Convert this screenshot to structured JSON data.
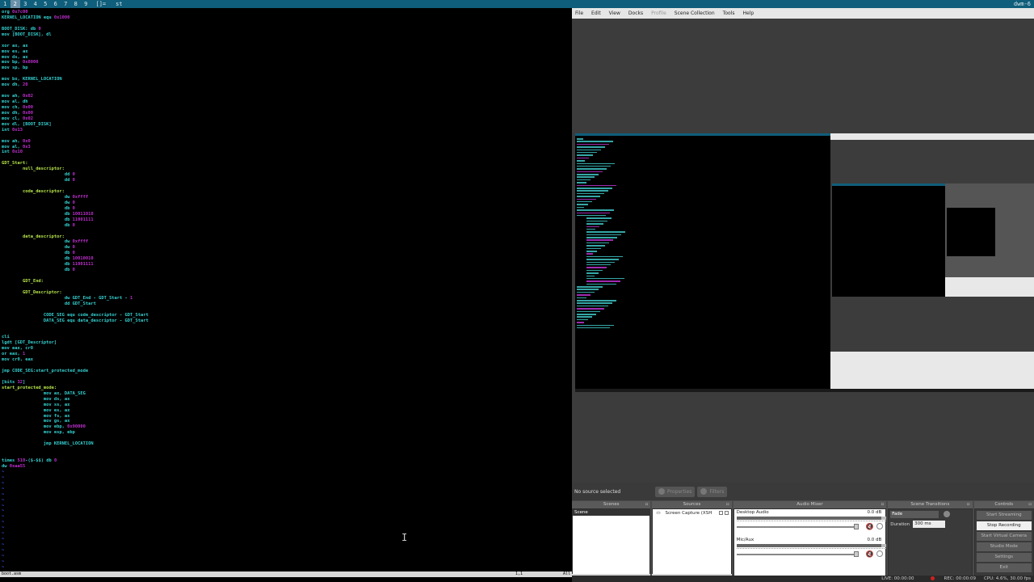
{
  "dwm": {
    "tags": [
      "1",
      "2",
      "3",
      "4",
      "5",
      "6",
      "7",
      "8",
      "9"
    ],
    "selected_tag": 1,
    "layout": "[]=",
    "window_title": "st",
    "status": "dwm-6"
  },
  "vim": {
    "lines": [
      [
        [
          "org ",
          "kw"
        ],
        [
          "0x7c00",
          "num"
        ]
      ],
      [
        [
          "KERNEL_LOCATION equ ",
          "kw"
        ],
        [
          "0x1000",
          "num"
        ]
      ],
      [],
      [
        [
          "BOOT_DISK: db ",
          "kw"
        ],
        [
          "0",
          "num"
        ]
      ],
      [
        [
          "mov [BOOT_DISK], dl",
          "kw"
        ]
      ],
      [],
      [
        [
          "xor ax, ax",
          "kw"
        ]
      ],
      [
        [
          "mov es, ax",
          "kw"
        ]
      ],
      [
        [
          "mov ds, ax",
          "kw"
        ]
      ],
      [
        [
          "mov bp, ",
          "kw"
        ],
        [
          "0x8000",
          "num"
        ]
      ],
      [
        [
          "mov sp, bp",
          "kw"
        ]
      ],
      [],
      [
        [
          "mov bx, KERNEL_LOCATION",
          "kw"
        ]
      ],
      [
        [
          "mov dh, ",
          "kw"
        ],
        [
          "20",
          "num"
        ]
      ],
      [],
      [
        [
          "mov ah, ",
          "kw"
        ],
        [
          "0x02",
          "num"
        ]
      ],
      [
        [
          "mov al, dh",
          "kw"
        ]
      ],
      [
        [
          "mov ch, ",
          "kw"
        ],
        [
          "0x00",
          "num"
        ]
      ],
      [
        [
          "mov dh, ",
          "kw"
        ],
        [
          "0x00",
          "num"
        ]
      ],
      [
        [
          "mov cl, ",
          "kw"
        ],
        [
          "0x02",
          "num"
        ]
      ],
      [
        [
          "mov dl, [BOOT_DISK]",
          "kw"
        ]
      ],
      [
        [
          "int ",
          "kw"
        ],
        [
          "0x13",
          "num"
        ]
      ],
      [],
      [
        [
          "mov ah, ",
          "kw"
        ],
        [
          "0x0",
          "num"
        ]
      ],
      [
        [
          "mov al, ",
          "kw"
        ],
        [
          "0x3",
          "num"
        ]
      ],
      [
        [
          "int ",
          "kw"
        ],
        [
          "0x10",
          "num"
        ]
      ],
      [],
      [
        [
          "GDT_Start:",
          "lb"
        ]
      ],
      [
        [
          "        null_descriptor:",
          "lb"
        ]
      ],
      [
        [
          "                        dd ",
          "kw"
        ],
        [
          "0",
          "num"
        ]
      ],
      [
        [
          "                        dd ",
          "kw"
        ],
        [
          "0",
          "num"
        ]
      ],
      [],
      [
        [
          "        code_descriptor:",
          "lb"
        ]
      ],
      [
        [
          "                        dw ",
          "kw"
        ],
        [
          "0xffff",
          "num"
        ]
      ],
      [
        [
          "                        dw ",
          "kw"
        ],
        [
          "0",
          "num"
        ]
      ],
      [
        [
          "                        db ",
          "kw"
        ],
        [
          "0",
          "num"
        ]
      ],
      [
        [
          "                        db ",
          "kw"
        ],
        [
          "10011010",
          "num"
        ]
      ],
      [
        [
          "                        db ",
          "kw"
        ],
        [
          "11001111",
          "num"
        ]
      ],
      [
        [
          "                        db ",
          "kw"
        ],
        [
          "0",
          "num"
        ]
      ],
      [],
      [
        [
          "        data_descriptor:",
          "lb"
        ]
      ],
      [
        [
          "                        dw ",
          "kw"
        ],
        [
          "0xffff",
          "num"
        ]
      ],
      [
        [
          "                        dw ",
          "kw"
        ],
        [
          "0",
          "num"
        ]
      ],
      [
        [
          "                        db ",
          "kw"
        ],
        [
          "0",
          "num"
        ]
      ],
      [
        [
          "                        db ",
          "kw"
        ],
        [
          "10010010",
          "num"
        ]
      ],
      [
        [
          "                        db ",
          "kw"
        ],
        [
          "11001111",
          "num"
        ]
      ],
      [
        [
          "                        db ",
          "kw"
        ],
        [
          "0",
          "num"
        ]
      ],
      [],
      [
        [
          "        GDT_End:",
          "lb"
        ]
      ],
      [],
      [
        [
          "        GDT_Descriptor:",
          "lb"
        ]
      ],
      [
        [
          "                        dw GDT_End - GDT_Start - ",
          "kw"
        ],
        [
          "1",
          "num"
        ]
      ],
      [
        [
          "                        dd GDT_Start",
          "kw"
        ]
      ],
      [],
      [
        [
          "                CODE_SEG equ code_descriptor - GDT_Start",
          "kw"
        ]
      ],
      [
        [
          "                DATA_SEG equ data_descriptor - GDT_Start",
          "kw"
        ]
      ],
      [],
      [],
      [
        [
          "cli",
          "kw"
        ]
      ],
      [
        [
          "lgdt [GDT_Descriptor]",
          "kw"
        ]
      ],
      [
        [
          "mov eax, cr0",
          "kw"
        ]
      ],
      [
        [
          "or eax, ",
          "kw"
        ],
        [
          "1",
          "num"
        ]
      ],
      [
        [
          "mov cr0, eax",
          "kw"
        ]
      ],
      [],
      [
        [
          "jmp CODE_SEG:start_protected_mode",
          "kw"
        ]
      ],
      [],
      [
        [
          "[bits ",
          "kw"
        ],
        [
          "32",
          "num"
        ],
        [
          "]",
          "kw"
        ]
      ],
      [
        [
          "start_protected_mode:",
          "lb"
        ]
      ],
      [
        [
          "                mov ax, DATA_SEG",
          "kw"
        ]
      ],
      [
        [
          "                mov ds, ax",
          "kw"
        ]
      ],
      [
        [
          "                mov ss, ax",
          "kw"
        ]
      ],
      [
        [
          "                mov es, ax",
          "kw"
        ]
      ],
      [
        [
          "                mov fs, ax",
          "kw"
        ]
      ],
      [
        [
          "                mov gs, ax",
          "kw"
        ]
      ],
      [
        [
          "                mov ebp, ",
          "kw"
        ],
        [
          "0x90000",
          "num"
        ]
      ],
      [
        [
          "                mov esp, ebp",
          "kw"
        ]
      ],
      [],
      [
        [
          "                jmp KERNEL_LOCATION",
          "kw"
        ]
      ],
      [],
      [],
      [
        [
          "times ",
          "kw"
        ],
        [
          "510",
          "num"
        ],
        [
          "-($-$$) db ",
          "kw"
        ],
        [
          "0",
          "num"
        ]
      ],
      [
        [
          "dw ",
          "kw"
        ],
        [
          "0xaa55",
          "num"
        ]
      ]
    ],
    "tildes": [
      "~",
      "~",
      "~",
      "~",
      "~",
      "~",
      "~",
      "~",
      "~",
      "~",
      "~",
      "~",
      "~",
      "~",
      "~",
      "~",
      "~",
      "~",
      "~"
    ],
    "status": {
      "filename": "boot.asm",
      "position": "1,1",
      "scroll": "All"
    }
  },
  "obs": {
    "menu": [
      "File",
      "Edit",
      "View",
      "Docks",
      "Profile",
      "Scene Collection",
      "Tools",
      "Help"
    ],
    "menu_dim_index": 4,
    "source_toolbar": {
      "no_source": "No source selected",
      "properties": "Properties",
      "filters": "Filters"
    },
    "scenes": {
      "title": "Scenes",
      "items": [
        "Scene"
      ]
    },
    "sources": {
      "title": "Sources",
      "items": [
        "Screen Capture (XSH"
      ]
    },
    "mixer": {
      "title": "Audio Mixer",
      "channels": [
        {
          "name": "Desktop Audio",
          "db": "0.0 dB",
          "level": 0.97
        },
        {
          "name": "Mic/Aux",
          "db": "0.0 dB",
          "level": 0.97
        }
      ]
    },
    "transitions": {
      "title": "Scene Transitions",
      "selected": "Fade",
      "duration_label": "Duration",
      "duration_value": "300 ms"
    },
    "controls": {
      "title": "Controls",
      "buttons": [
        "Start Streaming",
        "Stop Recording",
        "Start Virtual Camera",
        "Studio Mode",
        "Settings",
        "Exit"
      ],
      "active_index": 1
    },
    "status": {
      "live": "LIVE: 00:00:00",
      "rec": "REC: 00:00:09",
      "cpu": "CPU: 4.6%, 30.00 fps"
    },
    "colors": {
      "dwm_bar": "#0f5e7b",
      "keyword": "#35d0d0",
      "label": "#b5e34a",
      "number": "#c02ed0",
      "rec_dot": "#d02020"
    }
  }
}
